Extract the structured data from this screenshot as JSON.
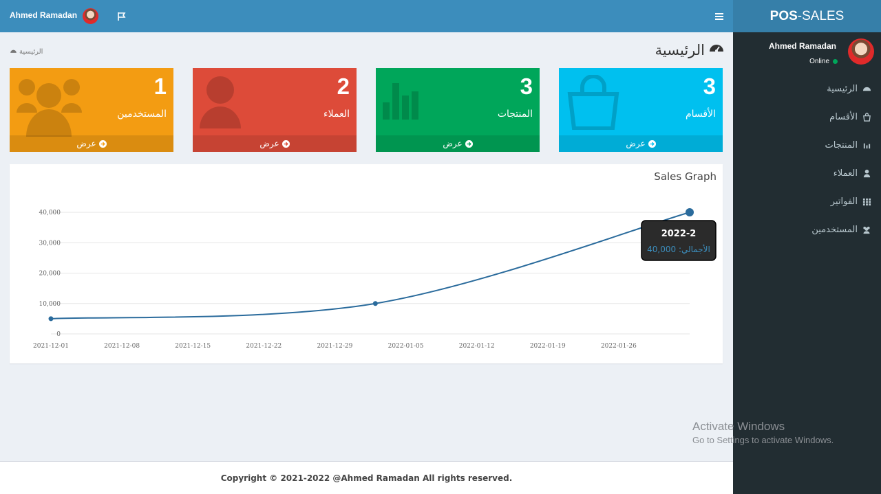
{
  "brand": {
    "bold": "POS",
    "rest": "-SALES"
  },
  "user": {
    "name": "Ahmed Ramadan",
    "status": "Online"
  },
  "sidebar": {
    "items": [
      {
        "label": "الرئيسية",
        "icon": "dashboard-icon"
      },
      {
        "label": "الأقسام",
        "icon": "shopping-bag-icon"
      },
      {
        "label": "المنتجات",
        "icon": "bar-chart-icon"
      },
      {
        "label": "العملاء",
        "icon": "user-icon"
      },
      {
        "label": "الفواتير",
        "icon": "grid-icon"
      },
      {
        "label": "المستخدمين",
        "icon": "users-icon"
      }
    ]
  },
  "header": {
    "title": "الرئيسية",
    "breadcrumb": "الرئيسية"
  },
  "boxes": [
    {
      "number": "3",
      "label": "الأقسام",
      "link": "عرض",
      "color": "#00c0ef",
      "icon": "shopping-bag-icon"
    },
    {
      "number": "3",
      "label": "المنتجات",
      "link": "عرض",
      "color": "#00a65a",
      "icon": "bar-chart-icon"
    },
    {
      "number": "2",
      "label": "العملاء",
      "link": "عرض",
      "color": "#dd4b39",
      "icon": "user-icon"
    },
    {
      "number": "1",
      "label": "المستخدمين",
      "link": "عرض",
      "color": "#f39c12",
      "icon": "users-icon"
    }
  ],
  "graph": {
    "title": "Sales Graph"
  },
  "chart_data": {
    "type": "line",
    "x": [
      "2021-12-01",
      "2022-01-02",
      "2022-02-02"
    ],
    "values": [
      5000,
      10000,
      40000
    ],
    "xticks": [
      "2021-12-01",
      "2021-12-08",
      "2021-12-15",
      "2021-12-22",
      "2021-12-29",
      "2022-01-05",
      "2022-01-12",
      "2022-01-19",
      "2022-01-26"
    ],
    "yticks": [
      "0",
      "10,000",
      "20,000",
      "30,000",
      "40,000"
    ],
    "ylim": [
      0,
      40000
    ],
    "grid": true,
    "tooltip": {
      "title": "2022-2",
      "label": "الأجمالي: 40,000"
    },
    "color": "#3c8dbc"
  },
  "footer": {
    "text": "Copyright © 2021-2022 @Ahmed Ramadan All rights reserved."
  },
  "watermark": {
    "line1": "Activate Windows",
    "line2": "Go to Settings to activate Windows."
  }
}
